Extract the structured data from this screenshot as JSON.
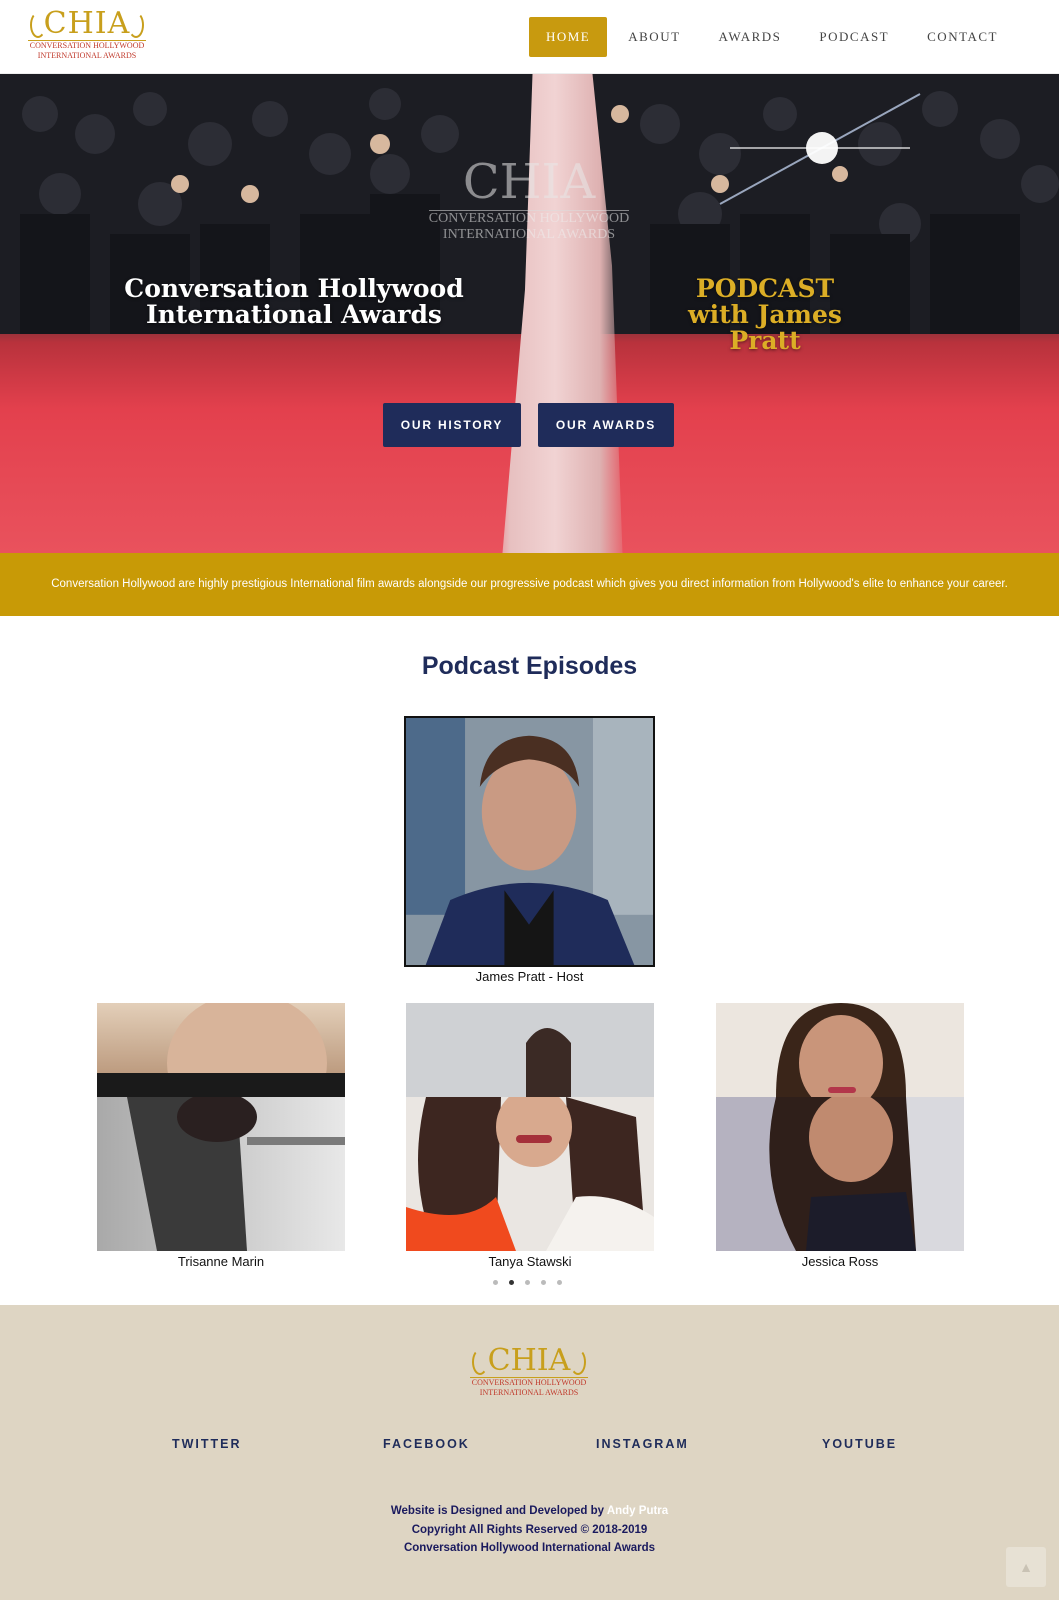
{
  "header": {
    "logo": {
      "text": "CHIA",
      "subtitle_line1": "Conversation Hollywood",
      "subtitle_line2": "International Awards"
    },
    "nav": [
      {
        "label": "Home",
        "active": true
      },
      {
        "label": "About",
        "active": false
      },
      {
        "label": "Awards",
        "active": false
      },
      {
        "label": "Podcast",
        "active": false
      },
      {
        "label": "Contact",
        "active": false
      }
    ]
  },
  "hero": {
    "overlay_logo": {
      "text": "CHIA",
      "line1": "Conversation Hollywood",
      "line2": "International Awards"
    },
    "title": "Conversation Hollywood International Awards",
    "podcast_line1": "PODCAST",
    "podcast_line2": "with James Pratt",
    "buttons": {
      "history": "Our History",
      "awards": "Our Awards"
    }
  },
  "band": {
    "text": "Conversation Hollywood are highly prestigious International film awards alongside our progressive podcast which gives you direct information from Hollywood's elite to enhance your career."
  },
  "podcast": {
    "title": "Podcast Episodes",
    "host_caption": "James Pratt - Host",
    "episodes": [
      {
        "name": "Trisanne Marin"
      },
      {
        "name": "Tanya Stawski"
      },
      {
        "name": "Jessica Ross"
      }
    ],
    "carousel": {
      "total": 5,
      "active_index": 1
    }
  },
  "footer": {
    "logo": {
      "text": "CHIA",
      "line1": "Conversation Hollywood",
      "line2": "International Awards"
    },
    "social": {
      "twitter": "Twitter",
      "facebook": "Facebook",
      "instagram": "Instagram",
      "youtube": "Youtube"
    },
    "credit_prefix": "Website is Designed and Developed by ",
    "developer": "Andy Putra",
    "copyright": "Copyright All Rights Reserved © 2018-2019",
    "org": "Conversation Hollywood International Awards"
  },
  "colors": {
    "gold": "#c89a06",
    "navy": "#1f2c5a",
    "footer_bg": "#ded5c3"
  },
  "icons": {
    "back_to_top": "chevron-up-icon"
  }
}
